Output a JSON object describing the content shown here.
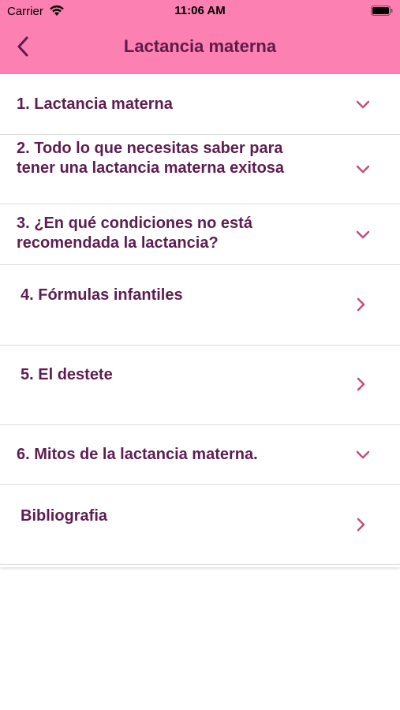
{
  "status_bar": {
    "carrier": "Carrier",
    "time": "11:06 AM"
  },
  "header": {
    "title": "Lactancia materna",
    "back_icon": "chevron-left-icon",
    "background": "#fc80b1",
    "title_color": "#5c1c4a"
  },
  "items": [
    {
      "label": "1. Lactancia materna",
      "icon": "chevron-down-icon"
    },
    {
      "label": "2. Todo lo que necesitas saber para tener una lactancia materna exitosa",
      "icon": "chevron-down-icon"
    },
    {
      "label": "3. ¿En qué condiciones no está recomendada la lactancia?",
      "icon": "chevron-down-icon"
    },
    {
      "label": "4. Fórmulas infantiles",
      "icon": "chevron-right-icon"
    },
    {
      "label": "5. El destete",
      "icon": "chevron-right-icon"
    },
    {
      "label": "6. Mitos de la lactancia materna.",
      "icon": "chevron-down-icon"
    },
    {
      "label": "Bibliografia",
      "icon": "chevron-right-icon"
    }
  ],
  "colors": {
    "accent": "#c0507e",
    "text": "#5e1d52"
  }
}
